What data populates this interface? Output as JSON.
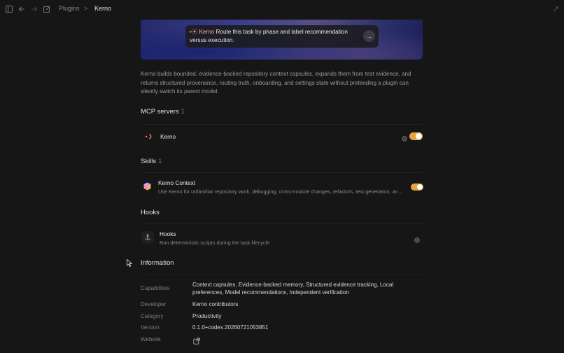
{
  "breadcrumb": {
    "parent": "Plugins",
    "separator": ">",
    "current": "Kerno"
  },
  "toolbar_icons": [
    "sidebar-toggle-icon",
    "back-arrow-icon",
    "forward-arrow-icon",
    "compose-icon",
    "corner-icon"
  ],
  "hero": {
    "badge": "Kerno",
    "prompt": "Route this task by phase and label recommendation versus execution.",
    "send_icon": "arrow-right-icon"
  },
  "description": "Kerno builds bounded, evidence-backed repository context capsules, expands them from test evidence, and returns structured provenance, routing truth, onboarding, and settings state without pretending a plugin can silently switch its parent model.",
  "mcp_servers": {
    "title": "MCP servers",
    "count": "1",
    "items": [
      {
        "name": "Kerno",
        "enabled": true,
        "icon": "kerno-logo-icon"
      }
    ]
  },
  "skills": {
    "title": "Skills",
    "count": "1",
    "items": [
      {
        "name": "Kerno Context",
        "description": "Use Kerno for unfamiliar repository work, debugging, cross-module changes, refactors, test generation, and onboarding.",
        "enabled": true,
        "icon": "cube-icon"
      }
    ]
  },
  "hooks": {
    "title": "Hooks",
    "items": [
      {
        "name": "Hooks",
        "description": "Run deterministic scripts during the task lifecycle",
        "icon": "anchor-icon"
      }
    ]
  },
  "information": {
    "title": "Information",
    "rows": [
      {
        "label": "Capabilities",
        "value": "Context capsules, Evidence-backed memory, Structured evidence tracking, Local preferences, Model recommendations, Independent verification"
      },
      {
        "label": "Developer",
        "value": "Kerno contributors"
      },
      {
        "label": "Category",
        "value": "Productivity"
      },
      {
        "label": "Version",
        "value": "0.1.0+codex.20260721053851"
      },
      {
        "label": "Website",
        "value": ""
      }
    ]
  },
  "colors": {
    "background": "#161616",
    "accent": "#e5a43a",
    "kerno_red": "#ff6b5e"
  }
}
